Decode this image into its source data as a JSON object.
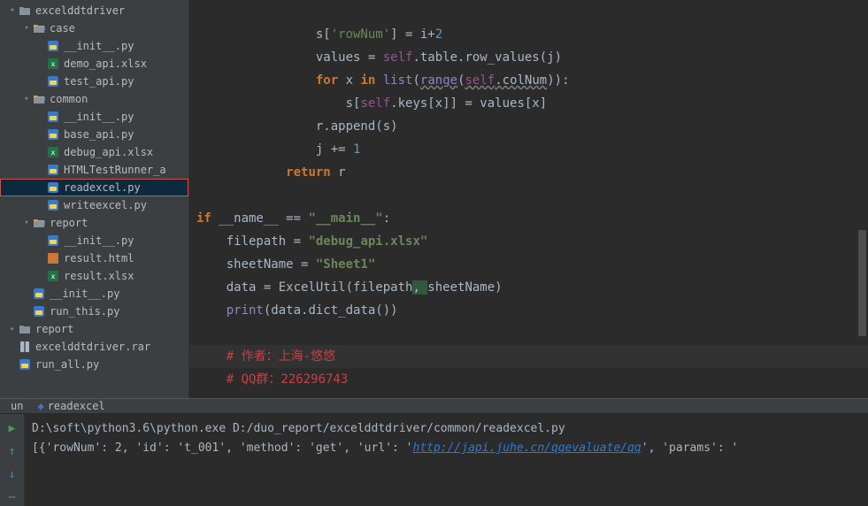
{
  "tree": {
    "root": "excelddtdriver",
    "items": [
      {
        "depth": 0,
        "arrow": "down",
        "icon": "folder",
        "label": "excelddtdriver"
      },
      {
        "depth": 1,
        "arrow": "down",
        "icon": "folder-open",
        "label": "case"
      },
      {
        "depth": 2,
        "arrow": "",
        "icon": "py",
        "label": "__init__.py"
      },
      {
        "depth": 2,
        "arrow": "",
        "icon": "xlsx",
        "label": "demo_api.xlsx"
      },
      {
        "depth": 2,
        "arrow": "",
        "icon": "py",
        "label": "test_api.py"
      },
      {
        "depth": 1,
        "arrow": "down",
        "icon": "folder-open",
        "label": "common"
      },
      {
        "depth": 2,
        "arrow": "",
        "icon": "py",
        "label": "__init__.py"
      },
      {
        "depth": 2,
        "arrow": "",
        "icon": "py",
        "label": "base_api.py"
      },
      {
        "depth": 2,
        "arrow": "",
        "icon": "xlsx",
        "label": "debug_api.xlsx"
      },
      {
        "depth": 2,
        "arrow": "",
        "icon": "py",
        "label": "HTMLTestRunner_a"
      },
      {
        "depth": 2,
        "arrow": "",
        "icon": "py",
        "label": "readexcel.py",
        "selected": true,
        "highlighted": true
      },
      {
        "depth": 2,
        "arrow": "",
        "icon": "py",
        "label": "writeexcel.py"
      },
      {
        "depth": 1,
        "arrow": "down",
        "icon": "folder-open",
        "label": "report"
      },
      {
        "depth": 2,
        "arrow": "",
        "icon": "py",
        "label": "__init__.py"
      },
      {
        "depth": 2,
        "arrow": "",
        "icon": "html",
        "label": "result.html"
      },
      {
        "depth": 2,
        "arrow": "",
        "icon": "xlsx",
        "label": "result.xlsx"
      },
      {
        "depth": 1,
        "arrow": "",
        "icon": "py",
        "label": "__init__.py"
      },
      {
        "depth": 1,
        "arrow": "",
        "icon": "py",
        "label": "run_this.py"
      },
      {
        "depth": 0,
        "arrow": "right",
        "icon": "folder",
        "label": "report"
      },
      {
        "depth": 0,
        "arrow": "",
        "icon": "rar",
        "label": "excelddtdriver.rar"
      },
      {
        "depth": 0,
        "arrow": "",
        "icon": "py",
        "label": "run_all.py"
      }
    ]
  },
  "code": {
    "l1_a": "                s[",
    "l1_b": "'rowNum'",
    "l1_c": "] = i+",
    "l1_d": "2",
    "l2_a": "                values = ",
    "l2_b": "self",
    "l2_c": ".table.row_values(j)",
    "l3_a": "                ",
    "l3_b": "for",
    "l3_c": " x ",
    "l3_d": "in",
    "l3_e": " ",
    "l3_f": "list",
    "l3_g": "(",
    "l3_h": "range",
    "l3_i": "(",
    "l3_j": "self",
    "l3_k": ".colNum",
    "l3_l": ")):",
    "l4_a": "                    s[",
    "l4_b": "self",
    "l4_c": ".keys[x]] = values[x]",
    "l5_a": "                r.append(s)",
    "l6_a": "                j += ",
    "l6_b": "1",
    "l7_a": "            ",
    "l7_b": "return",
    "l7_c": " r",
    "l8": "",
    "l9_a": "if",
    "l9_b": " __name__ == ",
    "l9_c": "\"__main__\"",
    "l9_d": ":",
    "l10_a": "    filepath = ",
    "l10_b": "\"debug_api.xlsx\"",
    "l11_a": "    sheetName = ",
    "l11_b": "\"Sheet1\"",
    "l12_a": "    data = ExcelUtil(filepath",
    "l12_b": ", ",
    "l12_c": "sheetName)",
    "l13_a": "    ",
    "l13_b": "print",
    "l13_c": "(data.dict_data())",
    "l14": "",
    "l15_a": "    ",
    "l15_b": "# 作者：上海-悠悠",
    "l16_a": "    ",
    "l16_b": "# QQ群：226296743"
  },
  "console": {
    "tab1": "un",
    "tab2": "readexcel",
    "cmd": "D:\\soft\\python3.6\\python.exe D:/duo_report/excelddtdriver/common/readexcel.py",
    "out_a": "[{'rowNum': 2, 'id': 't_001', 'method': 'get', 'url': '",
    "out_url": "http://japi.juhe.cn/qqevaluate/qq",
    "out_b": "', 'params': '"
  },
  "icons": {
    "rerun": "▶",
    "up": "↑",
    "down": "↓"
  }
}
